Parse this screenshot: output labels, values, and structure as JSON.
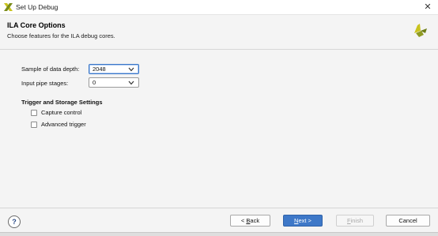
{
  "window": {
    "title": "Set Up Debug",
    "close_glyph": "✕"
  },
  "header": {
    "title": "ILA Core Options",
    "subtitle": "Choose features for the ILA debug cores."
  },
  "form": {
    "sample_depth": {
      "label": "Sample of data depth:",
      "value": "2048"
    },
    "pipe_stages": {
      "label": "Input pipe stages:",
      "value": "0"
    }
  },
  "trigger_section": {
    "title": "Trigger and Storage Settings",
    "capture_control": {
      "label": "Capture control",
      "checked": false
    },
    "advanced_trigger": {
      "label": "Advanced trigger",
      "checked": false
    }
  },
  "footer": {
    "help": "?",
    "back": {
      "prefix": "< ",
      "mnemonic": "B",
      "rest": "ack"
    },
    "next": {
      "mnemonic": "N",
      "rest": "ext >"
    },
    "finish": {
      "mnemonic": "F",
      "rest": "inish"
    },
    "cancel": "Cancel"
  },
  "colors": {
    "accent": "#3e78c8",
    "logo_yellow": "#c9c31e",
    "logo_green": "#7a8c1c"
  },
  "icons": {
    "app": "xilinx-logo-icon",
    "close": "close-icon",
    "dropdown": "chevron-down-icon"
  }
}
